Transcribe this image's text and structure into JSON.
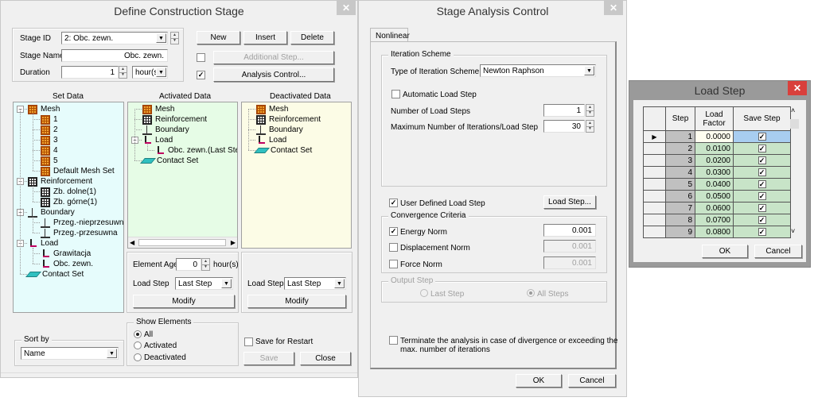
{
  "define_stage": {
    "title": "Define Construction Stage",
    "close_icon": "close-icon",
    "stage_id_label": "Stage ID",
    "stage_id_value": "2: Obc. zewn.",
    "stage_name_label": "Stage Name",
    "stage_name_value": "Obc. zewn.",
    "duration_label": "Duration",
    "duration_value": "1",
    "duration_unit": "hour(s",
    "new_label": "New",
    "insert_label": "Insert",
    "delete_label": "Delete",
    "additional_step_label": "Additional Step...",
    "additional_step_checked": false,
    "analysis_control_label": "Analysis Control...",
    "analysis_control_checked": true,
    "set_data": {
      "header": "Set Data",
      "items": [
        {
          "label": "Mesh",
          "icon": "mesh-icon",
          "level": 0
        },
        {
          "label": "1",
          "icon": "mesh-icon",
          "level": 1
        },
        {
          "label": "2",
          "icon": "mesh-icon",
          "level": 1
        },
        {
          "label": "3",
          "icon": "mesh-icon",
          "level": 1
        },
        {
          "label": "4",
          "icon": "mesh-icon",
          "level": 1
        },
        {
          "label": "5",
          "icon": "mesh-icon",
          "level": 1
        },
        {
          "label": "Default Mesh Set",
          "icon": "mesh-icon",
          "level": 1
        },
        {
          "label": "Reinforcement",
          "icon": "reinforcement-icon",
          "level": 0
        },
        {
          "label": "Zb. dolne(1)",
          "icon": "reinforcement-icon",
          "level": 1
        },
        {
          "label": "Zb. górne(1)",
          "icon": "reinforcement-icon",
          "level": 1
        },
        {
          "label": "Boundary",
          "icon": "boundary-icon",
          "level": 0
        },
        {
          "label": "Przeg.-nieprzesuwna",
          "icon": "boundary-icon",
          "level": 1
        },
        {
          "label": "Przeg.-przesuwna",
          "icon": "boundary-icon",
          "level": 1
        },
        {
          "label": "Load",
          "icon": "load-icon",
          "level": 0
        },
        {
          "label": "Grawitacja",
          "icon": "load-icon",
          "level": 1
        },
        {
          "label": "Obc. zewn.",
          "icon": "load-icon",
          "level": 1
        },
        {
          "label": "Contact Set",
          "icon": "contact-set-icon",
          "level": 0
        }
      ]
    },
    "activated_data": {
      "header": "Activated Data",
      "items": [
        {
          "label": "Mesh",
          "icon": "mesh-icon",
          "level": 0
        },
        {
          "label": "Reinforcement",
          "icon": "reinforcement-icon",
          "level": 0
        },
        {
          "label": "Boundary",
          "icon": "boundary-icon",
          "level": 0
        },
        {
          "label": "Load",
          "icon": "load-icon",
          "level": 0
        },
        {
          "label": "Obc. zewn.(Last Step)",
          "icon": "load-icon",
          "level": 1
        },
        {
          "label": "Contact Set",
          "icon": "contact-set-icon",
          "level": 0
        }
      ],
      "element_age_label": "Element Age",
      "element_age_value": "0",
      "element_age_unit": "hour(s)",
      "load_step_label": "Load Step",
      "load_step_value": "Last Step",
      "modify_label": "Modify"
    },
    "deactivated_data": {
      "header": "Deactivated Data",
      "items": [
        {
          "label": "Mesh",
          "icon": "mesh-icon",
          "level": 0
        },
        {
          "label": "Reinforcement",
          "icon": "reinforcement-icon",
          "level": 0
        },
        {
          "label": "Boundary",
          "icon": "boundary-icon",
          "level": 0
        },
        {
          "label": "Load",
          "icon": "load-icon",
          "level": 0
        },
        {
          "label": "Contact Set",
          "icon": "contact-set-icon",
          "level": 0
        }
      ],
      "load_step_label": "Load Step",
      "load_step_value": "Last Step",
      "modify_label": "Modify"
    },
    "sort_by_label": "Sort by",
    "sort_by_value": "Name",
    "show_elements_label": "Show Elements",
    "show_elements_options": [
      "All",
      "Activated",
      "Deactivated"
    ],
    "show_elements_selected": "All",
    "save_for_restart_label": "Save for Restart",
    "save_for_restart_checked": false,
    "save_label": "Save",
    "close_label": "Close",
    "colors": {
      "set_data_bg": "#e6fcfc",
      "activated_bg": "#e6fce6",
      "deactivated_bg": "#fcfce6"
    }
  },
  "analysis_control": {
    "title": "Stage Analysis Control",
    "tab_label": "Nonlinear",
    "iteration_scheme_label": "Iteration Scheme",
    "type_label": "Type of Iteration Scheme",
    "type_value": "Newton Raphson",
    "auto_load_step_label": "Automatic Load Step",
    "auto_load_step_checked": false,
    "num_load_steps_label": "Number of Load Steps",
    "num_load_steps_value": "1",
    "max_iter_label": "Maximum Number of Iterations/Load Step",
    "max_iter_value": "30",
    "user_defined_label": "User Defined Load Step",
    "user_defined_checked": true,
    "load_step_button": "Load Step...",
    "convergence_label": "Convergence Criteria",
    "energy_norm_label": "Energy Norm",
    "energy_norm_checked": true,
    "energy_norm_value": "0.001",
    "displacement_norm_label": "Displacement Norm",
    "displacement_norm_checked": false,
    "displacement_norm_value": "0.001",
    "force_norm_label": "Force Norm",
    "force_norm_checked": false,
    "force_norm_value": "0.001",
    "output_step_label": "Output Step",
    "last_step_label": "Last Step",
    "all_steps_label": "All Steps",
    "output_step_selected": "All Steps",
    "terminate_label_1": "Terminate the analysis in case of divergence or exceeding the",
    "terminate_label_2": "max. number of iterations",
    "terminate_checked": false,
    "ok_label": "OK",
    "cancel_label": "Cancel"
  },
  "load_step": {
    "title": "Load Step",
    "columns": [
      "Step",
      "Load",
      "Factor",
      "Save Step"
    ],
    "rows": [
      {
        "step": "1",
        "factor": "0.0000",
        "save": true,
        "current": true
      },
      {
        "step": "2",
        "factor": "0.0100",
        "save": true
      },
      {
        "step": "3",
        "factor": "0.0200",
        "save": true
      },
      {
        "step": "4",
        "factor": "0.0300",
        "save": true
      },
      {
        "step": "5",
        "factor": "0.0400",
        "save": true
      },
      {
        "step": "6",
        "factor": "0.0500",
        "save": true
      },
      {
        "step": "7",
        "factor": "0.0600",
        "save": true
      },
      {
        "step": "8",
        "factor": "0.0700",
        "save": true
      },
      {
        "step": "9",
        "factor": "0.0800",
        "save": true
      }
    ],
    "ok_label": "OK",
    "cancel_label": "Cancel",
    "colors": {
      "step_cell": "#c0c0c0",
      "factor_cell": "#c8e4c8",
      "selected": "#a8cdf0",
      "current_factor": "#fffef0"
    }
  }
}
